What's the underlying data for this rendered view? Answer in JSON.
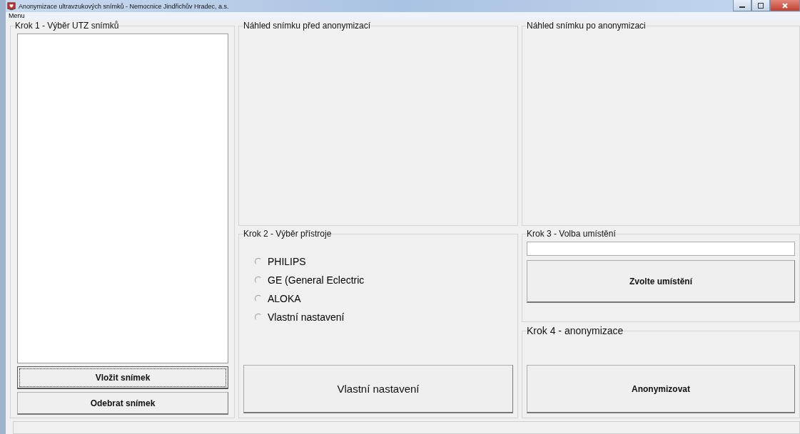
{
  "window": {
    "title": "Anonymizace ultravzukových snímků - Nemocnice Jindřichův Hradec, a.s."
  },
  "menu": [
    "Menu"
  ],
  "step1": {
    "title": "Krok 1 - Výběr UTZ snímků",
    "buttons": [
      {
        "label": "Vložit snímek",
        "focused": true
      },
      {
        "label": "Odebrat snímek",
        "focused": false
      }
    ]
  },
  "preview_before": {
    "title": "Náhled snímku před anonymizací"
  },
  "preview_after": {
    "title": "Náhled snímku po anonymizaci"
  },
  "step2": {
    "title": "Krok 2 - Výběr přístroje",
    "options": [
      {
        "label": "PHILIPS",
        "selected": false
      },
      {
        "label": "GE (General Eclectric",
        "selected": false
      },
      {
        "label": "ALOKA",
        "selected": false
      },
      {
        "label": "Vlastní nastavení",
        "selected": false
      }
    ],
    "button": "Vlastní nastavení"
  },
  "step3": {
    "title": "Krok 3 - Volba umístění",
    "button": "Zvolte umístění"
  },
  "step4": {
    "title": "Krok 4 - anonymizace",
    "button": "Anonymizovat"
  }
}
